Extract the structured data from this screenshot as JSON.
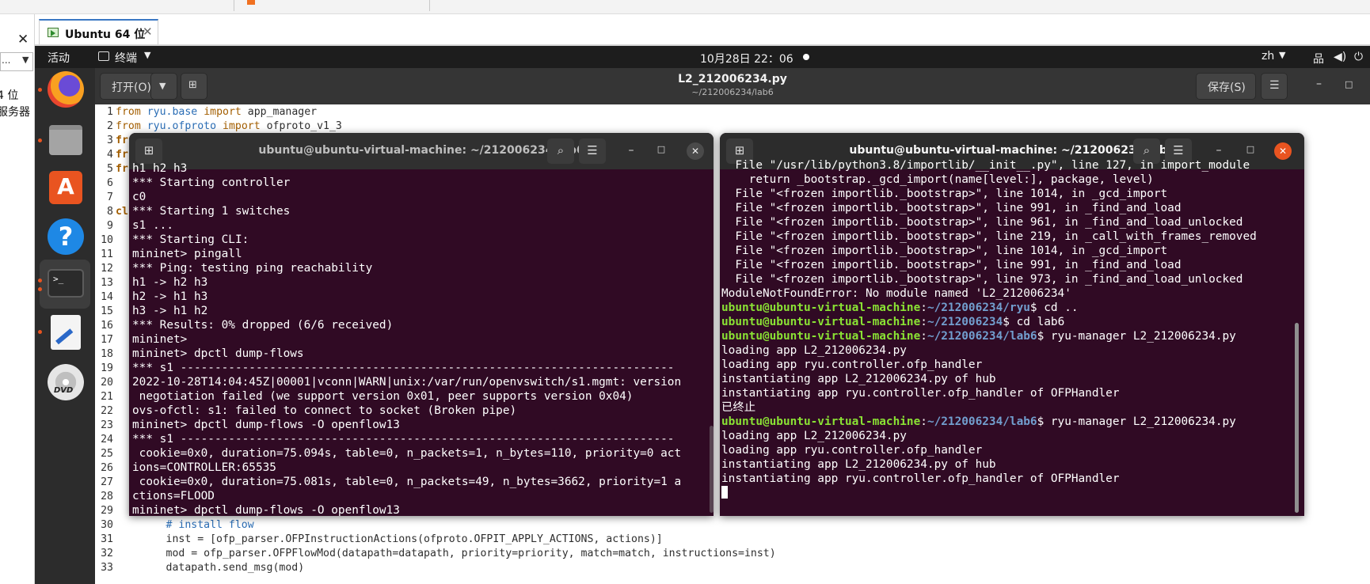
{
  "vmware": {
    "tab_label": "Ubuntu 64 位",
    "tab_close": "✕",
    "library_close": "✕",
    "library_dropdown_text": "...",
    "library_items": [
      "4 位",
      "服务器"
    ]
  },
  "topbar": {
    "activities": "活动",
    "app_menu": "终端",
    "clock": "10月28日  22：06",
    "lang": "zh"
  },
  "dock": {
    "items": [
      "firefox",
      "files",
      "software-store",
      "help",
      "terminal",
      "text-editor",
      "dvd"
    ]
  },
  "gedit": {
    "open_label": "打开(O)",
    "save_label": "保存(S)",
    "title": "L2_212006234.py",
    "subtitle": "~/212006234/lab6",
    "lines": [
      {
        "n": "1",
        "text": "from ryu.base import app_manager"
      },
      {
        "n": "2",
        "text": "from ryu.ofproto import ofproto_v1_3"
      },
      {
        "n": "3",
        "text": "fr"
      },
      {
        "n": "4",
        "text": "fr"
      },
      {
        "n": "5",
        "text": "fr"
      },
      {
        "n": "6",
        "text": ""
      },
      {
        "n": "7",
        "text": ""
      },
      {
        "n": "8",
        "text": "cl"
      },
      {
        "n": "9",
        "text": ""
      },
      {
        "n": "10",
        "text": ""
      },
      {
        "n": "11",
        "text": ""
      },
      {
        "n": "12",
        "text": ""
      },
      {
        "n": "13",
        "text": ""
      },
      {
        "n": "14",
        "text": ""
      },
      {
        "n": "15",
        "text": ""
      },
      {
        "n": "16",
        "text": ""
      },
      {
        "n": "17",
        "text": ""
      },
      {
        "n": "18",
        "text": ""
      },
      {
        "n": "19",
        "text": ""
      },
      {
        "n": "20",
        "text": ""
      },
      {
        "n": "21",
        "text": ""
      },
      {
        "n": "22",
        "text": ""
      },
      {
        "n": "23",
        "text": ""
      },
      {
        "n": "24",
        "text": ""
      },
      {
        "n": "25",
        "text": ""
      },
      {
        "n": "26",
        "text": ""
      },
      {
        "n": "27",
        "text": ""
      },
      {
        "n": "28",
        "text": ""
      },
      {
        "n": "29",
        "text": ""
      },
      {
        "n": "30",
        "text": "        # install flow"
      },
      {
        "n": "31",
        "text": "        inst = [ofp_parser.OFPInstructionActions(ofproto.OFPIT_APPLY_ACTIONS, actions)]"
      },
      {
        "n": "32",
        "text": "        mod = ofp_parser.OFPFlowMod(datapath=datapath, priority=priority, match=match, instructions=inst)"
      },
      {
        "n": "33",
        "text": "        datapath.send_msg(mod)"
      }
    ]
  },
  "terminal_left": {
    "title": "ubuntu@ubuntu-virtual-machine: ~/212006234/lab6",
    "lines": [
      "h1 h2 h3",
      "*** Starting controller",
      "c0",
      "*** Starting 1 switches",
      "s1 ...",
      "*** Starting CLI:",
      "mininet> pingall",
      "*** Ping: testing ping reachability",
      "h1 -> h2 h3",
      "h2 -> h1 h3",
      "h3 -> h1 h2",
      "*** Results: 0% dropped (6/6 received)",
      "mininet>",
      "mininet> dpctl dump-flows",
      "*** s1 ------------------------------------------------------------------------",
      "2022-10-28T14:04:45Z|00001|vconn|WARN|unix:/var/run/openvswitch/s1.mgmt: version",
      " negotiation failed (we support version 0x01, peer supports version 0x04)",
      "ovs-ofctl: s1: failed to connect to socket (Broken pipe)",
      "mininet> dpctl dump-flows -O openflow13",
      "*** s1 ------------------------------------------------------------------------",
      " cookie=0x0, duration=75.094s, table=0, n_packets=1, n_bytes=110, priority=0 act",
      "ions=CONTROLLER:65535",
      " cookie=0x0, duration=75.081s, table=0, n_packets=49, n_bytes=3662, priority=1 a",
      "ctions=FLOOD",
      "mininet> dpctl dump-flows -O openflow13"
    ]
  },
  "terminal_right": {
    "title": "ubuntu@ubuntu-virtual-machine: ~/212006234/lab6",
    "prompt_user": "ubuntu@ubuntu-virtual-machine",
    "lines": [
      {
        "t": "out",
        "text": "  File \"/usr/lib/python3.8/importlib/__init__.py\", line 127, in import_module"
      },
      {
        "t": "out",
        "text": "    return _bootstrap._gcd_import(name[level:], package, level)"
      },
      {
        "t": "out",
        "text": "  File \"<frozen importlib._bootstrap>\", line 1014, in _gcd_import"
      },
      {
        "t": "out",
        "text": "  File \"<frozen importlib._bootstrap>\", line 991, in _find_and_load"
      },
      {
        "t": "out",
        "text": "  File \"<frozen importlib._bootstrap>\", line 961, in _find_and_load_unlocked"
      },
      {
        "t": "out",
        "text": "  File \"<frozen importlib._bootstrap>\", line 219, in _call_with_frames_removed"
      },
      {
        "t": "out",
        "text": "  File \"<frozen importlib._bootstrap>\", line 1014, in _gcd_import"
      },
      {
        "t": "out",
        "text": "  File \"<frozen importlib._bootstrap>\", line 991, in _find_and_load"
      },
      {
        "t": "out",
        "text": "  File \"<frozen importlib._bootstrap>\", line 973, in _find_and_load_unlocked"
      },
      {
        "t": "out",
        "text": "ModuleNotFoundError: No module named 'L2_212006234'"
      },
      {
        "t": "prompt",
        "path": "~/212006234/ryu",
        "cmd": " cd .."
      },
      {
        "t": "prompt",
        "path": "~/212006234",
        "cmd": " cd lab6"
      },
      {
        "t": "prompt",
        "path": "~/212006234/lab6",
        "cmd": " ryu-manager L2_212006234.py"
      },
      {
        "t": "out",
        "text": "loading app L2_212006234.py"
      },
      {
        "t": "out",
        "text": "loading app ryu.controller.ofp_handler"
      },
      {
        "t": "out",
        "text": "instantiating app L2_212006234.py of hub"
      },
      {
        "t": "out",
        "text": "instantiating app ryu.controller.ofp_handler of OFPHandler"
      },
      {
        "t": "out",
        "text": "已终止"
      },
      {
        "t": "prompt",
        "path": "~/212006234/lab6",
        "cmd": " ryu-manager L2_212006234.py"
      },
      {
        "t": "out",
        "text": "loading app L2_212006234.py"
      },
      {
        "t": "out",
        "text": "loading app ryu.controller.ofp_handler"
      },
      {
        "t": "out",
        "text": "instantiating app L2_212006234.py of hub"
      },
      {
        "t": "out",
        "text": "instantiating app ryu.controller.ofp_handler of OFPHandler"
      }
    ]
  }
}
